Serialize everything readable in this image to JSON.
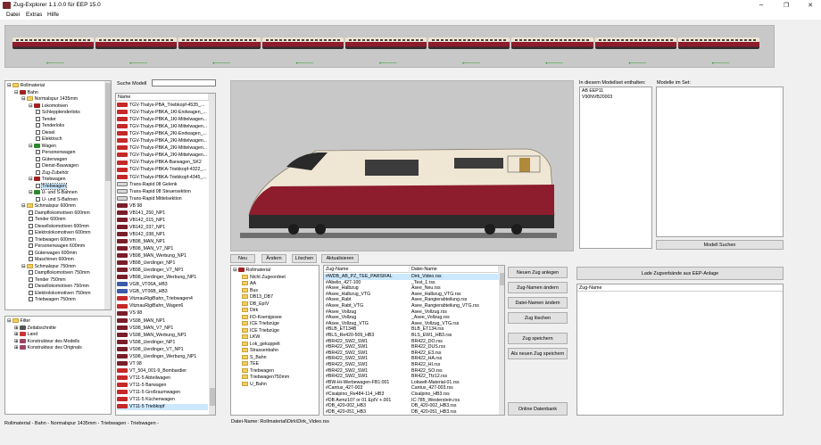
{
  "window": {
    "title": "Zug-Explorer   1.1.0.0 für EEP 15.0"
  },
  "window_controls": {
    "minimize": "─",
    "restore": "❐",
    "close": "✕"
  },
  "menu": [
    "Datei",
    "Extras",
    "Hilfe"
  ],
  "train_strip": {
    "car_count": 9
  },
  "category_tree": [
    {
      "label": "Rollmaterial",
      "depth": 0,
      "expander": "−",
      "kind": "folder"
    },
    {
      "label": "Bahn",
      "depth": 1,
      "expander": "−",
      "kind": "train"
    },
    {
      "label": "Normalspur 1435mm",
      "depth": 2,
      "expander": "−",
      "kind": "folder"
    },
    {
      "label": "Lokomotiven",
      "depth": 3,
      "expander": "−",
      "kind": "train"
    },
    {
      "label": "Schlepptenderloks",
      "depth": 4,
      "expander": "",
      "kind": "box"
    },
    {
      "label": "Tender",
      "depth": 4,
      "expander": "",
      "kind": "box"
    },
    {
      "label": "Tenderloks",
      "depth": 4,
      "expander": "",
      "kind": "box"
    },
    {
      "label": "Diesel",
      "depth": 4,
      "expander": "",
      "kind": "box"
    },
    {
      "label": "Elektrisch",
      "depth": 4,
      "expander": "",
      "kind": "box"
    },
    {
      "label": "Wagen",
      "depth": 3,
      "expander": "−",
      "kind": "wagon"
    },
    {
      "label": "Personenwagen",
      "depth": 4,
      "expander": "",
      "kind": "box"
    },
    {
      "label": "Güterwagen",
      "depth": 4,
      "expander": "",
      "kind": "box"
    },
    {
      "label": "Dienst-Bauwagen",
      "depth": 4,
      "expander": "",
      "kind": "box"
    },
    {
      "label": "Zug-Zubehör",
      "depth": 4,
      "expander": "",
      "kind": "box"
    },
    {
      "label": "Triebwagen",
      "depth": 3,
      "expander": "−",
      "kind": "train"
    },
    {
      "label": "Triebwagen",
      "depth": 4,
      "expander": "",
      "kind": "box",
      "selected": true
    },
    {
      "label": "U- und S-Bahnen",
      "depth": 3,
      "expander": "−",
      "kind": "sbahn"
    },
    {
      "label": "U- und S-Bahnen",
      "depth": 4,
      "expander": "",
      "kind": "box"
    },
    {
      "label": "Schmalspur 600mm",
      "depth": 2,
      "expander": "−",
      "kind": "folder"
    },
    {
      "label": "Dampflokomotiven 600mm",
      "depth": 3,
      "expander": "",
      "kind": "box"
    },
    {
      "label": "Tender 600mm",
      "depth": 3,
      "expander": "",
      "kind": "box"
    },
    {
      "label": "Diesellokomotiven 600mm",
      "depth": 3,
      "expander": "",
      "kind": "box"
    },
    {
      "label": "Elektrolokomotiven 600mm",
      "depth": 3,
      "expander": "",
      "kind": "box"
    },
    {
      "label": "Triebwagen 600mm",
      "depth": 3,
      "expander": "",
      "kind": "box"
    },
    {
      "label": "Personenwagen 600mm",
      "depth": 3,
      "expander": "",
      "kind": "box"
    },
    {
      "label": "Güterwagen 600mm",
      "depth": 3,
      "expander": "",
      "kind": "box"
    },
    {
      "label": "Maschinen 600mm",
      "depth": 3,
      "expander": "",
      "kind": "box"
    },
    {
      "label": "Schmalspur 750mm",
      "depth": 2,
      "expander": "−",
      "kind": "folder"
    },
    {
      "label": "Dampflokomotiven 750mm",
      "depth": 3,
      "expander": "",
      "kind": "box"
    },
    {
      "label": "Tender 750mm",
      "depth": 3,
      "expander": "",
      "kind": "box"
    },
    {
      "label": "Diesellokomotiven 750mm",
      "depth": 3,
      "expander": "",
      "kind": "box"
    },
    {
      "label": "Elektrolokomotiven 750mm",
      "depth": 3,
      "expander": "",
      "kind": "box"
    },
    {
      "label": "Triebwagen 750mm",
      "depth": 3,
      "expander": "",
      "kind": "box"
    }
  ],
  "filter_tree": [
    {
      "label": "Filter",
      "depth": 0,
      "expander": "−",
      "kind": "folder"
    },
    {
      "label": "Zeitabschnitte",
      "depth": 1,
      "expander": "+",
      "kind": "clock"
    },
    {
      "label": "Land",
      "depth": 1,
      "expander": "+",
      "kind": "flag"
    },
    {
      "label": "Konstrukteur des Modells",
      "depth": 1,
      "expander": "+",
      "kind": "person"
    },
    {
      "label": "Konstrukteur des Originals",
      "depth": 1,
      "expander": "+",
      "kind": "person"
    }
  ],
  "model_search": {
    "label": "Suche Modell",
    "value": ""
  },
  "model_list": {
    "header": "Name",
    "items": [
      {
        "name": "TGV-Thalys-PBA_Triebkopf-4535_...",
        "icon": "red"
      },
      {
        "name": "TGV-Thalys-PBKA_1Kl-Endwagen_...",
        "icon": "red"
      },
      {
        "name": "TGV-Thalys-PBKA_1Kl-Mittelwagen...",
        "icon": "red"
      },
      {
        "name": "TGV-Thalys-PBKA_1Kl-Mittelwagen...",
        "icon": "red"
      },
      {
        "name": "TGV-Thalys-PBKA_2Kl-Endwagen_...",
        "icon": "red"
      },
      {
        "name": "TGV-Thalys-PBKA_2Kl-Mittelwagen...",
        "icon": "red"
      },
      {
        "name": "TGV-Thalys-PBKA_2Kl-Mittelwagen...",
        "icon": "red"
      },
      {
        "name": "TGV-Thalys-PBKA_2Kl-Mittelwagen...",
        "icon": "red"
      },
      {
        "name": "TGV-Thalys-PBKA-Barwagen_SK2",
        "icon": "red"
      },
      {
        "name": "TGV-Thalys-PBKA-Triebkopf-4322_...",
        "icon": "red"
      },
      {
        "name": "TGV-Thalys-PBKA-Triebkopf-4345_...",
        "icon": "red"
      },
      {
        "name": "Trans-Rapid 08 Gelenk",
        "icon": "white"
      },
      {
        "name": "Trans-Rapid 08 Steuersektion",
        "icon": "white"
      },
      {
        "name": "Trans-Rapid Mittelsektion",
        "icon": "white"
      },
      {
        "name": "VB 98",
        "icon": "maroon"
      },
      {
        "name": "VB141_250_NP1",
        "icon": "maroon"
      },
      {
        "name": "VB142_015_NP1",
        "icon": "maroon"
      },
      {
        "name": "VB142_037_NP1",
        "icon": "maroon"
      },
      {
        "name": "VB142_038_NP1",
        "icon": "maroon"
      },
      {
        "name": "VB98_MAN_NP1",
        "icon": "maroon"
      },
      {
        "name": "VB98_MAN_V7_NP1",
        "icon": "maroon"
      },
      {
        "name": "VB98_MAN_Werbung_NP1",
        "icon": "maroon"
      },
      {
        "name": "VB98_Uerdinger_NP1",
        "icon": "maroon"
      },
      {
        "name": "VB98_Uerdinger_V7_NP1",
        "icon": "maroon"
      },
      {
        "name": "VB98_Uerdinger_Werbung_NP1",
        "icon": "maroon"
      },
      {
        "name": "VGB_VT06A_HB3",
        "icon": "blue"
      },
      {
        "name": "VGB_VT06B_HB3",
        "icon": "blue"
      },
      {
        "name": "VitznauRigiBahn_Triebwagen4",
        "icon": "red"
      },
      {
        "name": "VitznauRigiBahn_Wagen6",
        "icon": "red"
      },
      {
        "name": "VS 98",
        "icon": "maroon"
      },
      {
        "name": "VS98_MAN_NP1",
        "icon": "maroon"
      },
      {
        "name": "VS98_MAN_V7_NP1",
        "icon": "maroon"
      },
      {
        "name": "VS98_MAN_Werbung_NP1",
        "icon": "maroon"
      },
      {
        "name": "VS98_Uerdinger_NP1",
        "icon": "maroon"
      },
      {
        "name": "VS98_Uerdinger_V7_NP1",
        "icon": "maroon"
      },
      {
        "name": "VS98_Uerdinger_Werbung_NP1",
        "icon": "maroon"
      },
      {
        "name": "VT 98",
        "icon": "maroon"
      },
      {
        "name": "VT_504_001-9_Bombardier",
        "icon": "red"
      },
      {
        "name": "VT11-5 Abteilwagen",
        "icon": "red"
      },
      {
        "name": "VT11-5 Barwagen",
        "icon": "red"
      },
      {
        "name": "VT11-5 Großraumwagen",
        "icon": "red"
      },
      {
        "name": "VT11-5 Küchenwagen",
        "icon": "red"
      },
      {
        "name": "VT11-5 Triebkopf",
        "icon": "red",
        "selected": true
      }
    ]
  },
  "modelset": {
    "contains_label": "In diesem Modellset enthalten:",
    "contains_items": [
      "AB EEP11",
      "V90NVB20003"
    ],
    "set_label": "Modelle im Set:",
    "search_button": "Modell Suchen"
  },
  "train_toolbar": {
    "new": "Neu",
    "change": "Ändern",
    "delete": "Löschen",
    "refresh": "Aktualisieren"
  },
  "folder_tree": [
    {
      "label": "Rollmaterial",
      "depth": 0,
      "expander": "−",
      "kind": "train"
    },
    {
      "label": "Nicht Zugeordnet",
      "depth": 1,
      "expander": "",
      "kind": "folder"
    },
    {
      "label": "AA",
      "depth": 1,
      "expander": "",
      "kind": "folder"
    },
    {
      "label": "Bus",
      "depth": 1,
      "expander": "",
      "kind": "folder"
    },
    {
      "label": "DB13_DB7",
      "depth": 1,
      "expander": "",
      "kind": "folder"
    },
    {
      "label": "DB_EpIV",
      "depth": 1,
      "expander": "",
      "kind": "folder"
    },
    {
      "label": "Dirk",
      "depth": 1,
      "expander": "",
      "kind": "folder"
    },
    {
      "label": "FD-Koenigssee",
      "depth": 1,
      "expander": "",
      "kind": "folder"
    },
    {
      "label": "ICE Triebzüge",
      "depth": 1,
      "expander": "",
      "kind": "folder"
    },
    {
      "label": "ICE Triebzüge",
      "depth": 1,
      "expander": "",
      "kind": "folder"
    },
    {
      "label": "LKW",
      "depth": 1,
      "expander": "",
      "kind": "folder"
    },
    {
      "label": "Lok_gekuppelt",
      "depth": 1,
      "expander": "",
      "kind": "folder"
    },
    {
      "label": "Strassenbahn",
      "depth": 1,
      "expander": "",
      "kind": "folder"
    },
    {
      "label": "S_Bahn",
      "depth": 1,
      "expander": "",
      "kind": "folder"
    },
    {
      "label": "TEE",
      "depth": 1,
      "expander": "",
      "kind": "folder"
    },
    {
      "label": "Triebwagen",
      "depth": 1,
      "expander": "",
      "kind": "folder"
    },
    {
      "label": "Triebwagen750mm",
      "depth": 1,
      "expander": "",
      "kind": "folder"
    },
    {
      "label": "U_Bahn",
      "depth": 1,
      "expander": "",
      "kind": "folder"
    }
  ],
  "train_table": {
    "headers": [
      "Zug-Name",
      "Datei-Name"
    ],
    "rows": [
      [
        "#WDB_AB_PZ_TEE_PARSIFAL",
        "Dirk_Video.rss",
        true
      ],
      [
        "#Abelio_427-100",
        "_Test_1.rss",
        false
      ],
      [
        "#Asee_Halbzug",
        "Asee_Neu.rss",
        false
      ],
      [
        "#Asee_Halbzug_VTG",
        "Asee_Halbzug_VTG.rss",
        false
      ],
      [
        "#Asee_Rabt",
        "Asee_Rangierabteilung.rss",
        false
      ],
      [
        "#Asee_Rabt_VTG",
        "Asee_Rangierabteilung_VTG.rss",
        false
      ],
      [
        "#Asee_Vollzug",
        "Asee_Vollzug.rss",
        false
      ],
      [
        "#Asee_Vollzug",
        "_Asee_Vollzug.rss",
        false
      ],
      [
        "#Asee_Vollzug_VTG",
        "Asee_Vollzug_VTG.rss",
        false
      ],
      [
        "#BLB_ET134B",
        "BLB_ET134.rss",
        false
      ],
      [
        "#BLS_Re420-509_HB3",
        "BLS_EW1_HB3.rss",
        false
      ],
      [
        "#BR422_SW2_SW1",
        "BR422_DO.rss",
        false
      ],
      [
        "#BR422_SW2_SW1",
        "BR422_DUS.rss",
        false
      ],
      [
        "#BR422_SW2_SW1",
        "BR422_E3.rss",
        false
      ],
      [
        "#BR422_SW2_SW1",
        "BR422_HA.rss",
        false
      ],
      [
        "#BR422_SW2_SW1",
        "BR422_HI.rss",
        false
      ],
      [
        "#BR422_SW2_SW1",
        "BR422_SO.rss",
        false
      ],
      [
        "#BR422_SW2_SW1",
        "BR422_Tfz12.rss",
        false
      ],
      [
        "#BW-Hi-Werbewagen-FB1:001",
        "Lokwelt-Material-01.rss",
        false
      ],
      [
        "#Cantus_427-003",
        "Cantus_427-003.rss",
        false
      ],
      [
        "#Cisalpino_Re484-114_HB3",
        "Cisalpino_HB3.rss",
        false
      ],
      [
        "#DB Avmz107 or 01 EpIV +.001",
        "IC-785_Westerstein.rss",
        false
      ],
      [
        "#DB_420-002_HB3",
        "DB_420-002_HB3.rss",
        false
      ],
      [
        "#DB_420-051_HB3",
        "DB_420-051_HB3.rss",
        false
      ]
    ]
  },
  "action_buttons": {
    "create": "Neuen Zug anlegen",
    "rename": "Zug-Namen ändern",
    "rename_file": "Datei-Namen ändern",
    "delete": "Zug löschen",
    "save": "Zug speichern",
    "save_as": "Als neuen Zug speichern",
    "online_db": "Online Datenbank"
  },
  "eep": {
    "load_button": "Lade Zugverbände aus EEP-Anlage",
    "header": "Zug-Name"
  },
  "status": {
    "left": "Rollmaterial - Bahn - Normalspur 1435mm - Triebwagen - Triebwagen -",
    "right": "Datei-Name: Rollmaterial\\Dirk\\Dirk_Video.rss"
  }
}
